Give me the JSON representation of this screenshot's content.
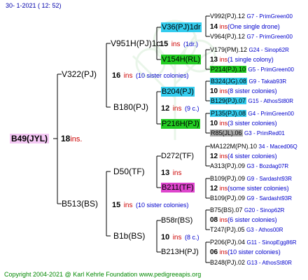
{
  "header": {
    "date": "30-   1-2021  (  12:  52)"
  },
  "footer": {
    "copyright": "Copyright 2004-2021 @ Karl Kehrle Foundation    www.pedigreeapis.org"
  },
  "root": {
    "id": "B49(JYL)",
    "count": "18",
    "ins": "ins."
  },
  "gen1": [
    {
      "id": "V322(PJ)"
    },
    {
      "id": "B513(BS)",
      "count": "15",
      "ins": "ins",
      "note": "(10 sister colonies)"
    }
  ],
  "gen2": [
    {
      "id": "V951H(PJ)1c",
      "count": "15",
      "ins": "ins",
      "note": "(1dr.)"
    },
    {
      "id": "B180(PJ)",
      "count": "12",
      "ins": "ins",
      "note": "(9 c.)"
    },
    {
      "id": "D50(TF)",
      "count": "13",
      "ins": "ins"
    },
    {
      "id": "B1b(BS)",
      "count": "10",
      "ins": "ins",
      "note": "(8 c.)"
    }
  ],
  "gen1_v322": {
    "count": "16",
    "ins": "ins",
    "note": "(10 sister colonies)"
  },
  "gen3": [
    {
      "id": "V36(PJ)1dr"
    },
    {
      "id": "V154H(RL)"
    },
    {
      "id": "B204(PJ)"
    },
    {
      "id": "P216H(PJ)"
    },
    {
      "id": "D272(TF)"
    },
    {
      "id": "B211(TF)"
    },
    {
      "id": "B58r(BS)"
    },
    {
      "id": "B213H(PJ)"
    }
  ],
  "gen4": [
    {
      "id": "V992(PJ).12",
      "info": "G7 - PrimGreen00"
    },
    {
      "count": "14",
      "ins": "ins",
      "note": "(One single drone)"
    },
    {
      "id": "V964(PJ).12",
      "info": "G7 - PrimGreen00"
    },
    {
      "id": "V179(PM).12",
      "info": "G24 - Sinop62R"
    },
    {
      "count": "13",
      "ins": "ins",
      "note": "(1 single colony)"
    },
    {
      "id": "P214(PJ).10",
      "info": "G5 - PrimGreen00"
    },
    {
      "id": "B324(JG).08",
      "info": "G9 - Takab93R"
    },
    {
      "count": "10",
      "ins": "ins",
      "note": "(8 sister colonies)"
    },
    {
      "id": "B129(PJ).07",
      "info": "G15 - AthosSt80R"
    },
    {
      "id": "P135(PJ).08",
      "info": "G4 - PrimGreen00"
    },
    {
      "count": "10",
      "ins": "ins",
      "note": "(3 sister colonies)"
    },
    {
      "id": "R85(JL).06",
      "info": "G3 - PrimRed01"
    },
    {
      "id": "MA122M(PN).10",
      "info": "34 - Maced06Q"
    },
    {
      "count": "12",
      "ins": "ins",
      "note": "(4 sister colonies)"
    },
    {
      "id": "A313(PJ).09",
      "info": "G3 - Bozdag07R"
    },
    {
      "id": "B109(PJ).09",
      "info": "G9 - Sardasht93R"
    },
    {
      "count": "12",
      "ins": "ins",
      "note": "(some sister colonies)"
    },
    {
      "id": "B109(PJ).09",
      "info": "G9 - Sardasht93R"
    },
    {
      "id": "B75(BS).07",
      "info": "G20 - Sinop62R"
    },
    {
      "count": "08",
      "ins": "ins",
      "note": "(6 sister colonies)"
    },
    {
      "id": "T247(PJ).05",
      "info": "G3 - Athos00R"
    },
    {
      "id": "P206(PJ).04",
      "info": "G11 - SinopEgg86R"
    },
    {
      "count": "06",
      "ins": "ins",
      "note": "(10 sister colonies)"
    },
    {
      "id": "B248(PJ).02",
      "info": "G13 - AthosSt80R"
    }
  ]
}
